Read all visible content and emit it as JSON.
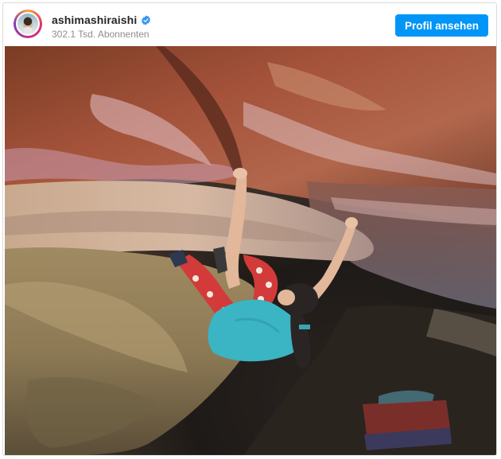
{
  "post": {
    "username": "ashimashiraishi",
    "subscribers": "302.1 Tsd. Abonnenten",
    "profile_button": "Profil ansehen",
    "verified": true,
    "icons": {
      "avatar": "avatar-image",
      "verified": "verified-badge-icon"
    },
    "colors": {
      "button": "#0095f6",
      "username": "#262626",
      "secondary_text": "#8e8e8e",
      "verified_badge": "#3897f0"
    },
    "photo": {
      "subject": "rock-climber-photo"
    }
  }
}
